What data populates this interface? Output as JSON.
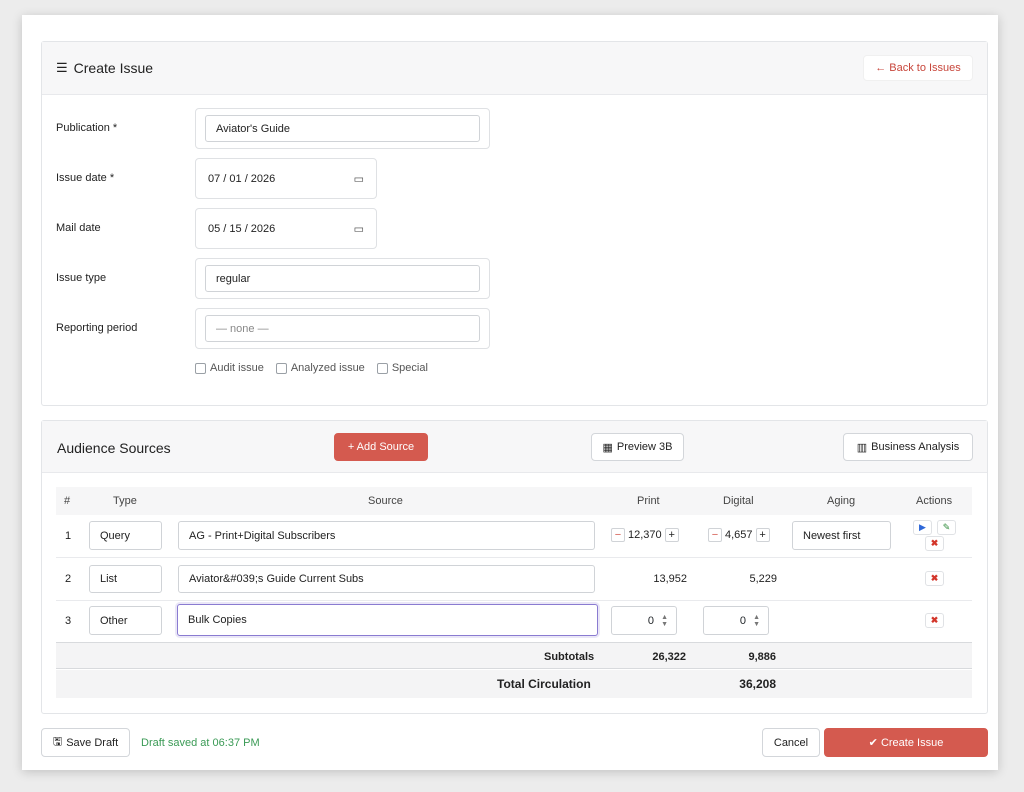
{
  "header": {
    "title": "Create Issue",
    "back_label": "← Back to Issues"
  },
  "form": {
    "publication": {
      "label": "Publication *",
      "value": "Aviator's Guide"
    },
    "issue_date": {
      "label": "Issue date *",
      "value": "07 / 01 / 2026"
    },
    "mail_date": {
      "label": "Mail date",
      "value": "05 / 15 / 2026"
    },
    "issue_type": {
      "label": "Issue type",
      "value": "regular"
    },
    "reporting_period": {
      "label": "Reporting period",
      "value": "— none —"
    },
    "checkboxes": {
      "audit": "Audit issue",
      "analyzed": "Analyzed issue",
      "special": "Special"
    }
  },
  "sources": {
    "title": "Audience Sources",
    "add_label": "+ Add Source",
    "preview_label": "Preview 3B",
    "analysis_label": "Business Analysis",
    "columns": {
      "num": "#",
      "type": "Type",
      "source": "Source",
      "print": "Print",
      "digital": "Digital",
      "aging": "Aging",
      "actions": "Actions"
    },
    "rows": [
      {
        "num": "1",
        "type": "Query",
        "source": "AG - Print+Digital Subscribers",
        "print": "12,370",
        "digital": "4,657",
        "aging": "Newest first"
      },
      {
        "num": "2",
        "type": "List",
        "source": "Aviator&#039;s Guide Current Subs",
        "print": "13,952",
        "digital": "5,229",
        "aging": ""
      },
      {
        "num": "3",
        "type": "Other",
        "source": "Bulk Copies",
        "print": "0",
        "digital": "0",
        "aging": ""
      }
    ],
    "subtotals_label": "Subtotals",
    "subtotal_print": "26,322",
    "subtotal_digital": "9,886",
    "total_label": "Total Circulation",
    "total_value": "36,208"
  },
  "footer": {
    "save_label": "Save Draft",
    "status": "Draft saved at 06:37 PM",
    "cancel_label": "Cancel",
    "create_label": "✔ Create Issue"
  },
  "colors": {
    "accent": "#d45a4f",
    "status": "#3a9a55",
    "focus": "#8a7bd1"
  }
}
